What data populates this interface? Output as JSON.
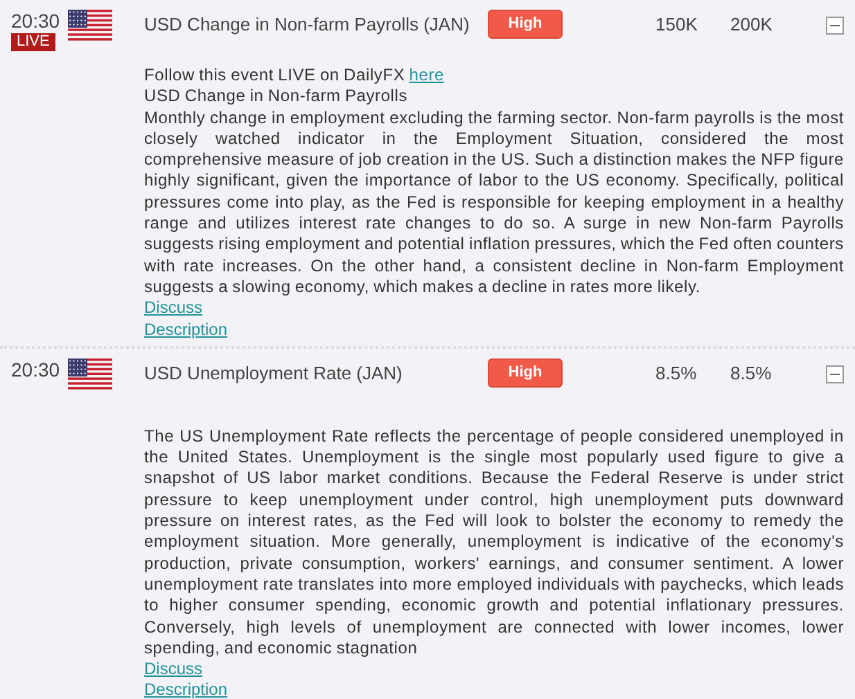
{
  "events": [
    {
      "time": "20:30",
      "live_label": "LIVE",
      "title": "USD Change in Non-farm Payrolls (JAN)",
      "importance": "High",
      "actual": "150K",
      "forecast": "200K",
      "expanded": true,
      "follow": {
        "text": "Follow this event LIVE on DailyFX",
        "link": "here"
      },
      "subtitle": "USD Change in Non-farm Payrolls",
      "description": "Monthly change in employment excluding the farming sector. Non-farm payrolls is the most closely watched indicator in the Employment Situation, considered the most comprehensive measure of job creation in the US. Such a distinction makes the NFP figure highly significant, given the importance of labor to the US economy. Specifically, political pressures come into play, as the Fed is responsible for keeping employment in a healthy range and utilizes interest rate changes to do so. A surge in new Non-farm Payrolls suggests rising employment and potential inflation pressures, which the Fed often counters with rate increases. On the other hand, a consistent decline in Non-farm Employment suggests a slowing economy, which makes a decline in rates more likely.",
      "links": [
        "Discuss",
        "Description"
      ]
    },
    {
      "time": "20:30",
      "title": "USD Unemployment Rate (JAN)",
      "importance": "High",
      "actual": "8.5%",
      "forecast": "8.5%",
      "expanded": true,
      "description": "The US Unemployment Rate reflects the percentage of people considered unemployed in the United States. Unemployment is the single most popularly used figure to give a snapshot of US labor market conditions. Because the Federal Reserve is under strict pressure to keep unemployment under control, high unemployment puts downward pressure on interest rates, as the Fed will look to bolster the economy to remedy the employment situation. More generally, unemployment is indicative of the economy's production, private consumption, workers' earnings, and consumer sentiment. A lower unemployment rate translates into more employed individuals with paychecks, which leads to higher consumer spending, economic growth and potential inflationary pressures. Conversely, high levels of unemployment are connected with lower incomes, lower spending, and economic stagnation",
      "links": [
        "Discuss",
        "Description"
      ]
    }
  ]
}
